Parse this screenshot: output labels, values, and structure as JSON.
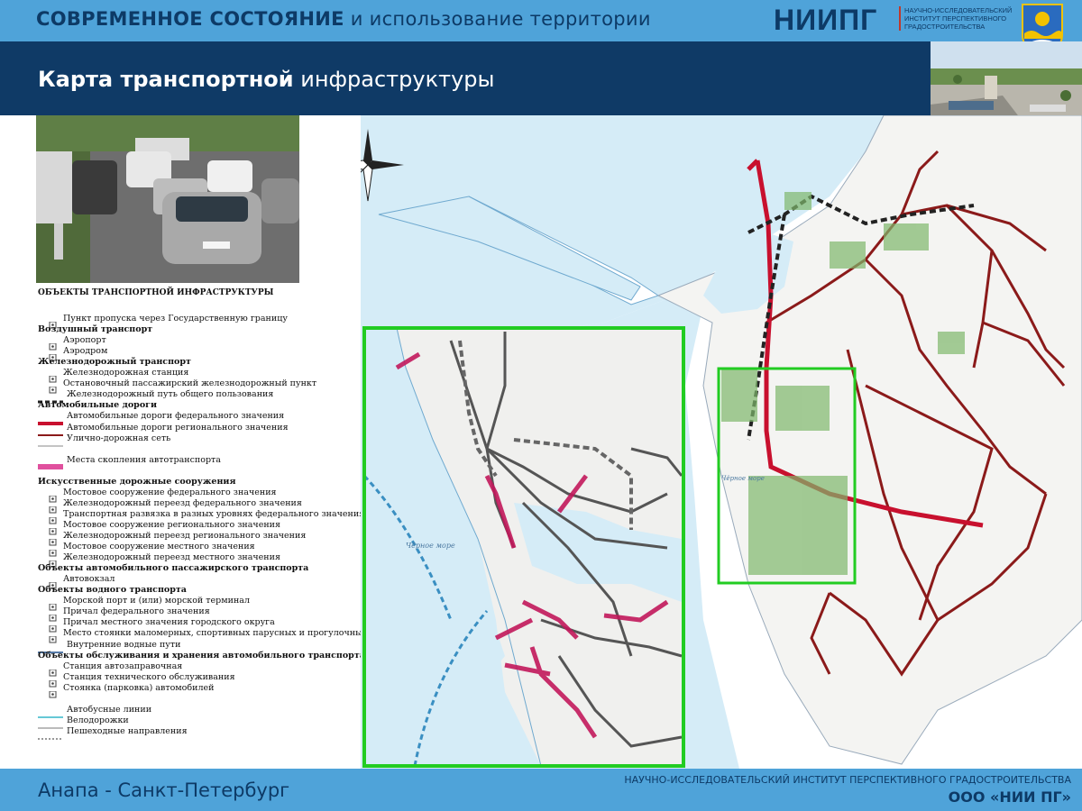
{
  "header": {
    "title_bold": "СОВРЕМЕННОЕ СОСТОЯНИЕ",
    "title_rest": " и использование территории",
    "logo": "НИИПГ",
    "logo_sub": "НАУЧНО-ИССЛЕДОВАТЕЛЬСКИЙ ИНСТИТУТ ПЕРСПЕКТИВНОГО ГРАДОСТРОИТЕЛЬСТВА"
  },
  "subheader": {
    "title_bold": "Карта транспортной",
    "title_rest": " инфраструктуры"
  },
  "legend": {
    "title": "ОБЪЕКТЫ ТРАНСПОРТНОЙ ИНФРАСТРУКТУРЫ",
    "items": [
      {
        "text": "Пункт пропуска через Государственную границу",
        "kind": "icon",
        "header": false
      },
      {
        "text": "Воздушный транспорт",
        "kind": "none",
        "header": true
      },
      {
        "text": "Аэропорт",
        "kind": "icon",
        "header": false
      },
      {
        "text": "Аэродром",
        "kind": "icon",
        "header": false
      },
      {
        "text": "Железнодорожный транспорт",
        "kind": "none",
        "header": true
      },
      {
        "text": "Железнодорожная станция",
        "kind": "icon",
        "header": false
      },
      {
        "text": "Остановочный пассажирский железнодорожный пункт",
        "kind": "icon",
        "header": false
      },
      {
        "text": "Железнодорожный путь общего пользования",
        "kind": "rail",
        "header": false
      },
      {
        "text": "Автомобильные дороги",
        "kind": "none",
        "header": true
      },
      {
        "text": "Автомобильные дороги федерального значения",
        "kind": "fed",
        "header": false
      },
      {
        "text": "Автомобильные дороги регионального значения",
        "kind": "reg",
        "header": false
      },
      {
        "text": "Улично-дорожная сеть",
        "kind": "street",
        "header": false
      },
      {
        "text": "",
        "kind": "none",
        "header": false
      },
      {
        "text": "Места скопления автотранспорта",
        "kind": "jam",
        "header": false
      },
      {
        "text": "",
        "kind": "none",
        "header": false
      },
      {
        "text": "Искусственные дорожные сооружения",
        "kind": "none",
        "header": true
      },
      {
        "text": "Мостовое сооружение федерального значения",
        "kind": "icon",
        "header": false
      },
      {
        "text": "Железнодорожный переезд федерального значения",
        "kind": "icon",
        "header": false
      },
      {
        "text": "Транспортная развязка в разных уровнях федерального значения",
        "kind": "icon",
        "header": false
      },
      {
        "text": "Мостовое сооружение регионального значения",
        "kind": "icon",
        "header": false
      },
      {
        "text": "Железнодорожный переезд регионального значения",
        "kind": "icon",
        "header": false
      },
      {
        "text": "Мостовое сооружение местного значения",
        "kind": "icon",
        "header": false
      },
      {
        "text": "Железнодорожный переезд местного значения",
        "kind": "icon",
        "header": false
      },
      {
        "text": "Объекты автомобильного пассажирского транспорта",
        "kind": "none",
        "header": true
      },
      {
        "text": "Автовокзал",
        "kind": "icon",
        "header": false
      },
      {
        "text": "Объекты водного транспорта",
        "kind": "none",
        "header": true
      },
      {
        "text": "Морской порт и (или) морской терминал",
        "kind": "icon",
        "header": false
      },
      {
        "text": "Причал федерального значения",
        "kind": "icon",
        "header": false
      },
      {
        "text": "Причал местного значения городского округа",
        "kind": "icon",
        "header": false
      },
      {
        "text": "Место стоянки маломерных, спортивных парусных и прогулочных судов",
        "kind": "icon",
        "header": false
      },
      {
        "text": "Внутренние водные пути",
        "kind": "water",
        "header": false
      },
      {
        "text": "Объекты обслуживания и хранения автомобильного транспорта",
        "kind": "none",
        "header": true
      },
      {
        "text": "Станция автозаправочная",
        "kind": "icon",
        "header": false
      },
      {
        "text": "Станция технического обслуживания",
        "kind": "icon",
        "header": false
      },
      {
        "text": "Стоянка (парковка) автомобилей",
        "kind": "icon",
        "header": false
      },
      {
        "text": "",
        "kind": "none",
        "header": false
      },
      {
        "text": "Автобусные линии",
        "kind": "bus",
        "header": false
      },
      {
        "text": "Велодорожки",
        "kind": "bike",
        "header": false
      },
      {
        "text": "Пешеходные направления",
        "kind": "walk",
        "header": false
      }
    ]
  },
  "map": {
    "sea_label": "Чёрное море",
    "sea_label_main": "Чёрное море"
  },
  "colors": {
    "header_blue": "#4fa3d9",
    "header_dark": "#0f3a66",
    "federal_road": "#c8102e",
    "regional_road": "#8b1a1a",
    "congestion": "#e0509e",
    "inset_frame": "#22cc22",
    "water": "#d5ecf7"
  },
  "footer": {
    "city": "Анапа - Санкт-Петербург",
    "institute": "НАУЧНО-ИССЛЕДОВАТЕЛЬСКИЙ ИНСТИТУТ ПЕРСПЕКТИВНОГО ГРАДОСТРОИТЕЛЬСТВА",
    "org": "ООО «НИИ ПГ»"
  }
}
